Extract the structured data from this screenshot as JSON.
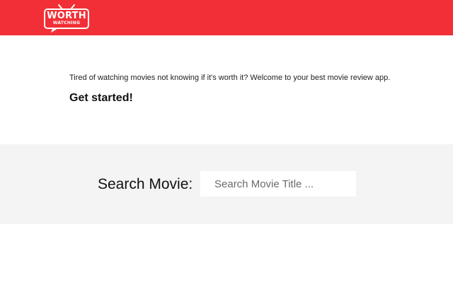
{
  "header": {
    "logo": {
      "line1": "WORTH",
      "line2": "WATCHING",
      "icon": "tv-logo-icon"
    },
    "background_color": "#f22f36"
  },
  "main": {
    "intro": "Tired of watching movies not knowing if it's worth it? Welcome to your best movie review app.",
    "cta": "Get started!"
  },
  "search": {
    "label": "Search Movie:",
    "placeholder": "Search Movie Title ...",
    "value": ""
  }
}
